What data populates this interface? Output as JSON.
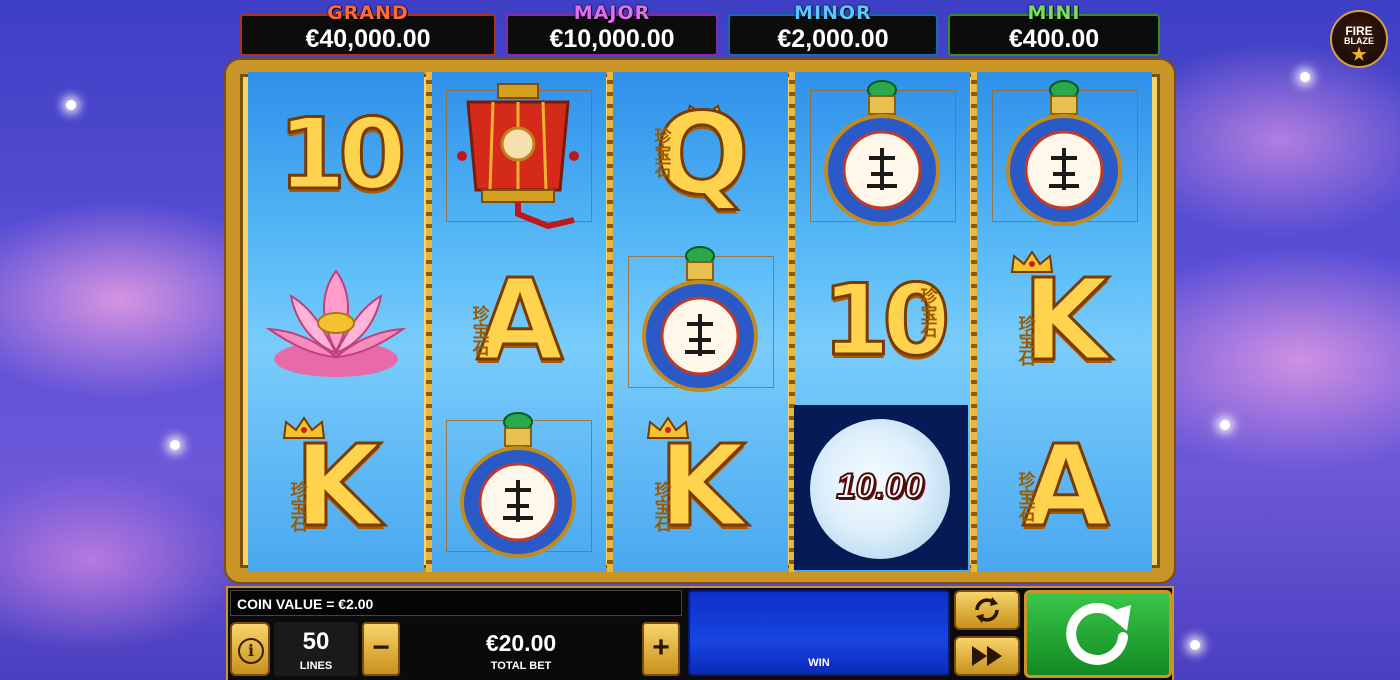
{
  "jackpots": [
    {
      "label": "GRAND",
      "value": "€40,000.00",
      "color": "#e0482a"
    },
    {
      "label": "MAJOR",
      "value": "€10,000.00",
      "color": "#c24cd6"
    },
    {
      "label": "MINOR",
      "value": "€2,000.00",
      "color": "#3aa6e8"
    },
    {
      "label": "MINI",
      "value": "€400.00",
      "color": "#58c13c"
    }
  ],
  "logo": {
    "line1": "FIRE",
    "line2": "BLAZE",
    "star": "★"
  },
  "reels": [
    [
      "10",
      "lotus",
      "K"
    ],
    [
      "lantern",
      "A",
      "snuff-bottle"
    ],
    [
      "Q",
      "snuff-bottle",
      "K"
    ],
    [
      "snuff-bottle",
      "10",
      "moon"
    ],
    [
      "snuff-bottle",
      "K",
      "A"
    ]
  ],
  "moon_value": "10.00",
  "han_chars": [
    "珍",
    "宝",
    "石"
  ],
  "controls": {
    "coin_value": "COIN VALUE = €2.00",
    "lines_value": "50",
    "lines_label": "LINES",
    "minus": "−",
    "plus": "+",
    "total_bet_value": "€20.00",
    "total_bet_label": "TOTAL BET",
    "win_label": "WIN"
  },
  "colors": {
    "gold": "#c99526",
    "spin_green": "#25a835",
    "win_blue": "#1845e0"
  }
}
